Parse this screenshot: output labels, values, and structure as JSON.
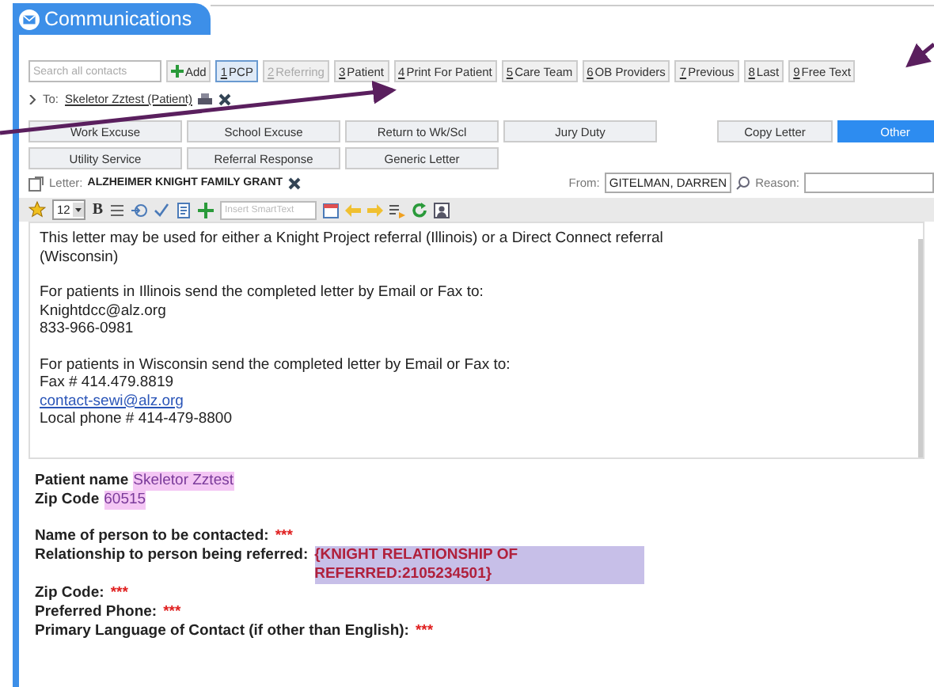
{
  "header": {
    "title": "Communications"
  },
  "contact_bar": {
    "search_placeholder": "Search all contacts",
    "add_label": "Add",
    "contacts": [
      {
        "key": "1",
        "label": "PCP",
        "selected": true,
        "disabled": false
      },
      {
        "key": "2",
        "label": "Referring",
        "selected": false,
        "disabled": true
      },
      {
        "key": "3",
        "label": "Patient",
        "selected": false,
        "disabled": false
      },
      {
        "key": "4",
        "label": "Print For Patient",
        "selected": false,
        "disabled": false
      },
      {
        "key": "5",
        "label": "Care Team",
        "selected": false,
        "disabled": false
      },
      {
        "key": "6",
        "label": "OB Providers",
        "selected": false,
        "disabled": false
      },
      {
        "key": "7",
        "label": "Previous",
        "selected": false,
        "disabled": false
      },
      {
        "key": "8",
        "label": "Last",
        "selected": false,
        "disabled": false
      },
      {
        "key": "9",
        "label": "Free Text",
        "selected": false,
        "disabled": false
      }
    ]
  },
  "recipient": {
    "label": "To:",
    "name": "Skeletor Zztest (Patient)"
  },
  "templates": [
    [
      {
        "label": "Work Excuse",
        "selected": false
      },
      {
        "label": "School Excuse",
        "selected": false
      },
      {
        "label": "Return to Wk/Scl",
        "selected": false
      },
      {
        "label": "Jury Duty",
        "selected": false
      }
    ],
    [
      {
        "label": "Utility Service",
        "selected": false
      },
      {
        "label": "Referral Response",
        "selected": false
      },
      {
        "label": "Generic Letter",
        "selected": false
      }
    ]
  ],
  "template_actions": [
    {
      "label": "Copy Letter",
      "selected": false
    },
    {
      "label": "Other",
      "selected": true
    }
  ],
  "letter": {
    "label": "Letter:",
    "name": "ALZHEIMER KNIGHT FAMILY GRANT",
    "from_label": "From:",
    "from_value": "GITELMAN, DARREN",
    "reason_label": "Reason:"
  },
  "toolbar": {
    "font_size": "12",
    "bold": "B",
    "smarttext_placeholder": "Insert SmartText"
  },
  "body": [
    [
      {
        "kind": "text",
        "text": "This letter may be used for either a Knight Project referral (Illinois) or a Direct Connect referral (Wisconsin)"
      }
    ],
    [
      {
        "kind": "text",
        "text": "For patients in Illinois send the completed letter by Email or Fax to:"
      },
      {
        "kind": "text",
        "text": "Knightdcc@alz.org"
      },
      {
        "kind": "text",
        "text": "833-966-0981"
      }
    ],
    [
      {
        "kind": "text",
        "text": "For patients in Wisconsin send the completed letter by Email or Fax to:"
      },
      {
        "kind": "text",
        "text": "Fax # 414.479.8819"
      },
      {
        "kind": "link",
        "text": "contact-sewi@alz.org"
      },
      {
        "kind": "text",
        "text": "Local phone # 414-479-8800"
      }
    ]
  ],
  "form": [
    [
      {
        "label": "Patient name",
        "value": "Skeletor Zztest",
        "kind": "filled"
      },
      {
        "label": "Zip Code",
        "value": "60515",
        "kind": "filled"
      }
    ],
    [
      {
        "label": "Name of person to be contacted:",
        "value": "***",
        "kind": "required"
      },
      {
        "label": "Relationship to person being referred:",
        "value": "{KNIGHT RELATIONSHIP OF REFERRED:2105234501}",
        "kind": "smartlink"
      },
      {
        "label": "Zip Code:",
        "value": "***",
        "kind": "required"
      },
      {
        "label": "Preferred Phone:",
        "value": "***",
        "kind": "required"
      },
      {
        "label": "Primary Language of Contact (if other than English):",
        "value": "***",
        "kind": "required"
      }
    ]
  ]
}
